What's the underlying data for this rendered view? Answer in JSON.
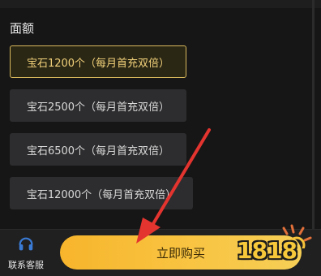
{
  "section": {
    "title": "面额"
  },
  "options": [
    {
      "label": "宝石1200个（每月首充双倍）",
      "selected": true
    },
    {
      "label": "宝石2500个（每月首充双倍）",
      "selected": false
    },
    {
      "label": "宝石6500个（每月首充双倍）",
      "selected": false
    },
    {
      "label": "宝石12000个（每月首充双倍）",
      "selected": false
    }
  ],
  "bottom": {
    "support_label": "联系客服",
    "buy_label": "立即购买"
  },
  "watermark": {
    "text": "1818"
  },
  "colors": {
    "accent": "#f6c33a",
    "selected_border": "#d9b95c",
    "arrow": "#e3342f",
    "support_icon": "#3a7bd5"
  }
}
